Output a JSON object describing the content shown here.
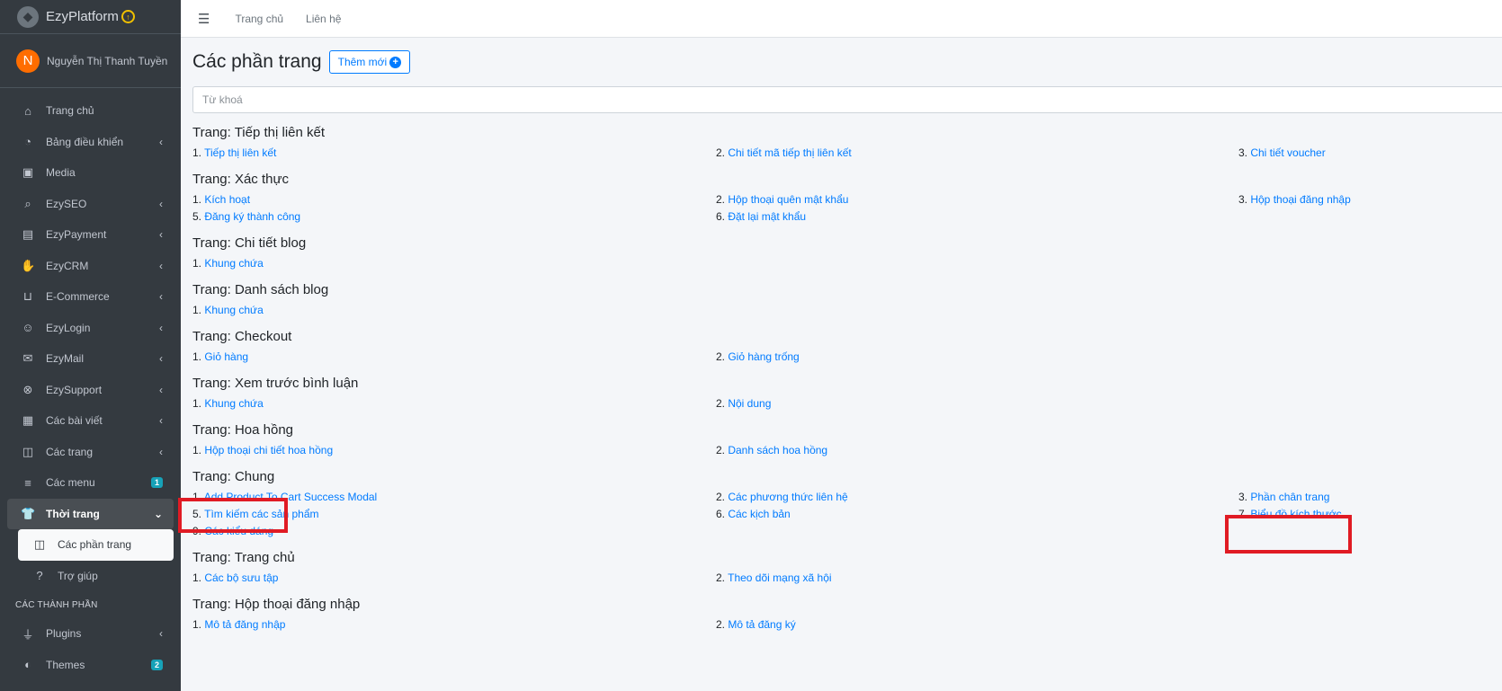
{
  "brand": {
    "name": "EzyPlatform",
    "badge": "↑"
  },
  "user": {
    "initial": "N",
    "name": "Nguyễn Thị Thanh Tuyền"
  },
  "sidebar": {
    "items": [
      {
        "label": "Trang chủ",
        "icon": "home-icon",
        "chevron": false
      },
      {
        "label": "Bảng điều khiển",
        "icon": "dashboard-icon",
        "chevron": true
      },
      {
        "label": "Media",
        "icon": "image-icon",
        "chevron": false
      },
      {
        "label": "EzySEO",
        "icon": "search-icon",
        "chevron": true
      },
      {
        "label": "EzyPayment",
        "icon": "credit-card-icon",
        "chevron": true
      },
      {
        "label": "EzyCRM",
        "icon": "handshake-icon",
        "chevron": true
      },
      {
        "label": "E-Commerce",
        "icon": "basket-icon",
        "chevron": true
      },
      {
        "label": "EzyLogin",
        "icon": "user-lock-icon",
        "chevron": true
      },
      {
        "label": "EzyMail",
        "icon": "envelope-icon",
        "chevron": true
      },
      {
        "label": "EzySupport",
        "icon": "lifebuoy-icon",
        "chevron": true
      },
      {
        "label": "Các bài viết",
        "icon": "newspaper-icon",
        "chevron": true
      },
      {
        "label": "Các trang",
        "icon": "columns-icon",
        "chevron": true
      },
      {
        "label": "Các menu",
        "icon": "bars-icon",
        "badge": "1"
      },
      {
        "label": "Thời trang",
        "icon": "tshirt-icon",
        "chevron": true,
        "open": true
      }
    ],
    "sub_items": [
      {
        "label": "Các phần trang",
        "icon": "columns-icon",
        "active": true
      },
      {
        "label": "Trợ giúp",
        "icon": "question-icon",
        "active": false
      }
    ],
    "header": "CÁC THÀNH PHẦN",
    "bottom_items": [
      {
        "label": "Plugins",
        "icon": "plug-icon",
        "chevron": true
      },
      {
        "label": "Themes",
        "icon": "palette-icon",
        "badge": "2"
      }
    ]
  },
  "topbar": {
    "links": [
      "Trang chủ",
      "Liên hệ"
    ]
  },
  "page": {
    "title": "Các phần trang",
    "add_label": "Thêm mới",
    "search_placeholder": "Từ khoá"
  },
  "sections": [
    {
      "title": "Trang: Tiếp thị liên kết",
      "items": [
        "1. Tiếp thị liên kết",
        "2. Chi tiết mã tiếp thị liên kết",
        "3. Chi tiết voucher"
      ]
    },
    {
      "title": "Trang: Xác thực",
      "items": [
        "1. Kích hoạt",
        "2. Hộp thoại quên mật khẩu",
        "3. Hộp thoại đăng nhập",
        "5. Đăng ký thành công",
        "6. Đặt lại mật khẩu"
      ]
    },
    {
      "title": "Trang: Chi tiết blog",
      "items": [
        "1. Khung chứa"
      ]
    },
    {
      "title": "Trang: Danh sách blog",
      "items": [
        "1. Khung chứa"
      ]
    },
    {
      "title": "Trang: Checkout",
      "items": [
        "1. Giỏ hàng",
        "2. Giỏ hàng trống"
      ]
    },
    {
      "title": "Trang: Xem trước bình luận",
      "items": [
        "1. Khung chứa",
        "2. Nội dung"
      ]
    },
    {
      "title": "Trang: Hoa hồng",
      "items": [
        "1. Hộp thoại chi tiết hoa hồng",
        "2. Danh sách hoa hồng"
      ]
    },
    {
      "title": "Trang: Chung",
      "items": [
        "1. Add Product To Cart Success Modal",
        "2. Các phương thức liên hệ",
        "3. Phần chân trang",
        "5. Tìm kiếm các sản phẩm",
        "6. Các kịch bản",
        "7. Biểu đồ kích thước",
        "9. Các kiểu dáng"
      ]
    },
    {
      "title": "Trang: Trang chủ",
      "items": [
        "1. Các bộ sưu tập",
        "2. Theo dõi mạng xã hội"
      ]
    },
    {
      "title": "Trang: Hộp thoại đăng nhập",
      "items": [
        "1. Mô tả đăng nhập",
        "2. Mô tả đăng ký"
      ]
    }
  ],
  "colors": {
    "sidebar": "#343a40",
    "link": "#007bff",
    "highlight": "#e01b24",
    "badge": "#17a2b8"
  }
}
